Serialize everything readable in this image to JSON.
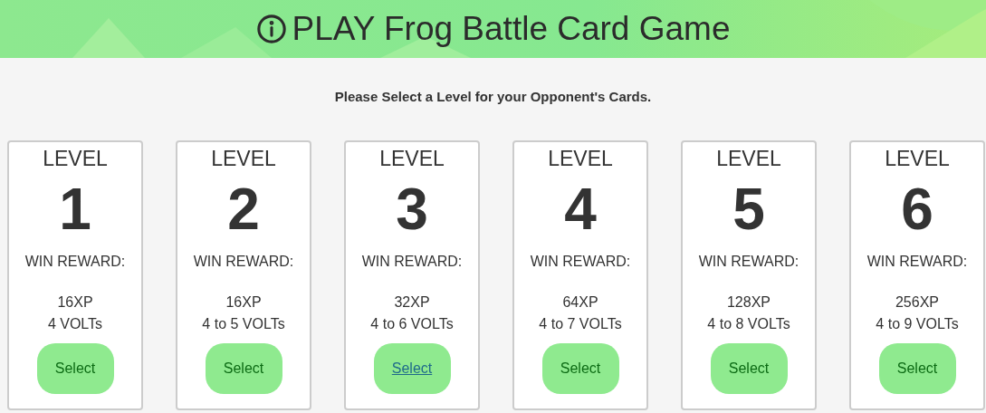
{
  "header": {
    "title": "PLAY Frog Battle Card Game"
  },
  "prompt": "Please Select a Level for your Opponent's Cards.",
  "levels": [
    {
      "heading": "LEVEL",
      "number": "1",
      "reward_label": "WIN REWARD:",
      "xp": "16XP",
      "volts": "4 VOLTs",
      "button": "Select",
      "hovered": false
    },
    {
      "heading": "LEVEL",
      "number": "2",
      "reward_label": "WIN REWARD:",
      "xp": "16XP",
      "volts": "4 to 5 VOLTs",
      "button": "Select",
      "hovered": false
    },
    {
      "heading": "LEVEL",
      "number": "3",
      "reward_label": "WIN REWARD:",
      "xp": "32XP",
      "volts": "4 to 6 VOLTs",
      "button": "Select",
      "hovered": true
    },
    {
      "heading": "LEVEL",
      "number": "4",
      "reward_label": "WIN REWARD:",
      "xp": "64XP",
      "volts": "4 to 7 VOLTs",
      "button": "Select",
      "hovered": false
    },
    {
      "heading": "LEVEL",
      "number": "5",
      "reward_label": "WIN REWARD:",
      "xp": "128XP",
      "volts": "4 to 8 VOLTs",
      "button": "Select",
      "hovered": false
    },
    {
      "heading": "LEVEL",
      "number": "6",
      "reward_label": "WIN REWARD:",
      "xp": "256XP",
      "volts": "4 to 9 VOLTs",
      "button": "Select",
      "hovered": false
    }
  ]
}
